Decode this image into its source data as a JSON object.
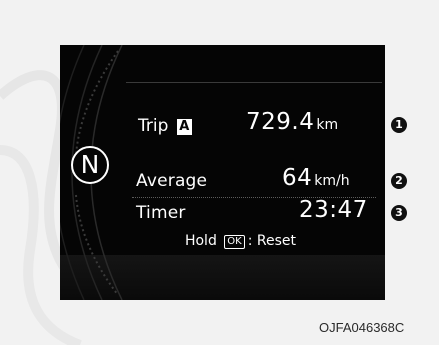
{
  "display": {
    "gear": "N",
    "trip": {
      "label": "Trip",
      "badge": "A",
      "value": "729.4",
      "unit": "km"
    },
    "average": {
      "label": "Average",
      "value": "64",
      "unit": "km/h"
    },
    "timer": {
      "label": "Timer",
      "value": "23:47"
    },
    "reset": {
      "prefix": "Hold",
      "key": "OK",
      "suffix": ": Reset"
    }
  },
  "callouts": [
    "1",
    "2",
    "3"
  ],
  "figure_code": "OJFA046368C"
}
